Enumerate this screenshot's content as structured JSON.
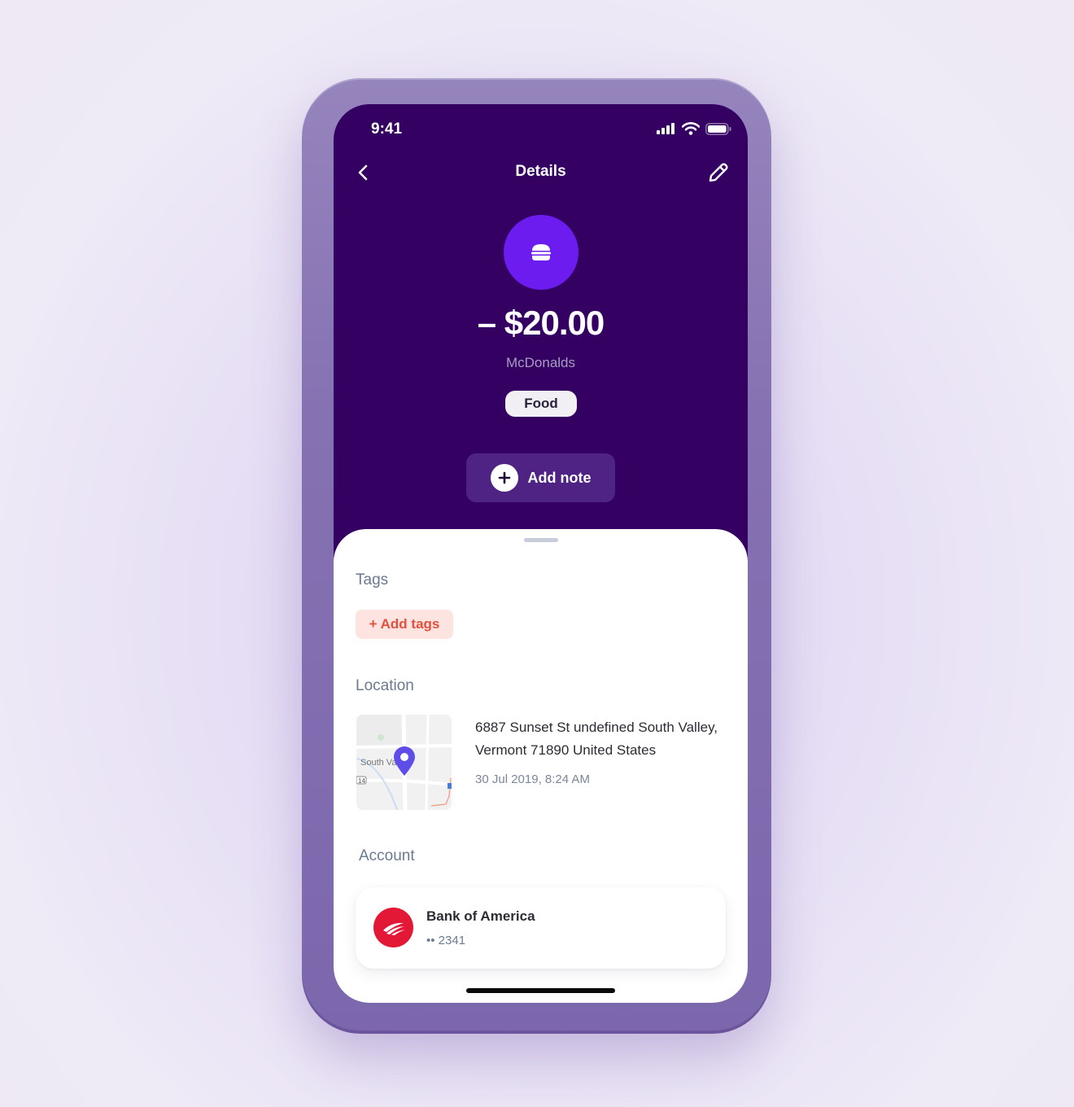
{
  "status_bar": {
    "time": "9:41"
  },
  "nav": {
    "title": "Details"
  },
  "transaction": {
    "amount": "– $20.00",
    "merchant": "McDonalds",
    "category": "Food",
    "add_note_label": "Add note"
  },
  "tags": {
    "title": "Tags",
    "add_label": "+ Add tags"
  },
  "location": {
    "title": "Location",
    "map_label": "South Va",
    "road_label": "14",
    "address": "6887 Sunset St undefined South Valley, Vermont 71890 United States",
    "timestamp": "30 Jul 2019, 8:24 AM"
  },
  "account": {
    "title": "Account",
    "bank_name": "Bank of America",
    "account_number": "•• 2341"
  },
  "colors": {
    "header_bg": "#340062",
    "accent_purple": "#6d1cf0",
    "tag_red": "#e4503f",
    "bank_red": "#e31837"
  },
  "icons": {
    "back": "chevron-left-icon",
    "edit": "pencil-icon",
    "merchant": "burger-icon",
    "note": "plus-icon",
    "map_pin": "map-pin-icon",
    "bank": "bank-of-america-logo"
  }
}
